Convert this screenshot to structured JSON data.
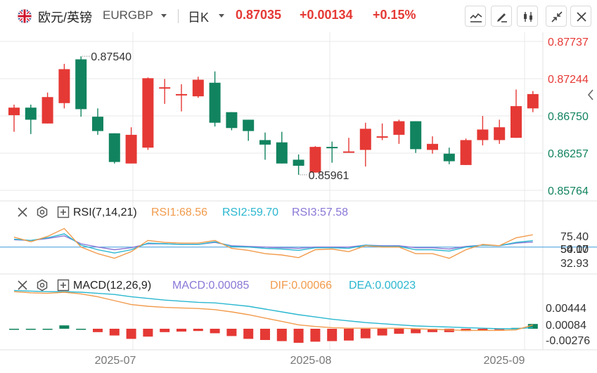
{
  "header": {
    "symbol_name": "欧元/英镑",
    "symbol_code": "EURGBP",
    "period": "日K",
    "price": "0.87035",
    "change": "+0.00134",
    "change_pct": "+0.15%"
  },
  "toolbar": {
    "icons": [
      "line-chart-icon",
      "draw-pencil-icon",
      "candle-type-icon",
      "collapse-icon",
      "close-icon"
    ]
  },
  "colors": {
    "up": "#e53935",
    "down": "#11835f",
    "rsi1": "#f29b4c",
    "rsi2": "#2ab7cf",
    "rsi3": "#8a77d6",
    "macd": "#8a77d6",
    "dif": "#f29b4c",
    "dea": "#2ab7cf",
    "grid": "#e8e8e8",
    "ref_line": "#3a9ad9"
  },
  "rsi": {
    "name": "RSI(7,14,21)",
    "rsi1_label": "RSI1:68.56",
    "rsi2_label": "RSI2:59.70",
    "rsi3_label": "RSI3:57.58"
  },
  "macd": {
    "name": "MACD(12,26,9)",
    "macd_label": "MACD:0.00085",
    "dif_label": "DIF:0.00066",
    "dea_label": "DEA:0.00023"
  },
  "chart_data": {
    "type": "candlestick",
    "price_axis": {
      "ticks": [
        0.87737,
        0.87244,
        0.8675,
        0.86257,
        0.85764
      ],
      "labels": [
        "0.87737",
        "0.87244",
        "0.86750",
        "0.86257",
        "0.85764"
      ]
    },
    "annotations": {
      "high_label": "0.87540",
      "low_label": "0.85961"
    },
    "x_labels": [
      "2025-07",
      "2025-08",
      "2025-09"
    ],
    "x_label_after_index": [
      7,
      18,
      29
    ],
    "candles": [
      {
        "o": 0.8676,
        "h": 0.869,
        "l": 0.8654,
        "c": 0.8686
      },
      {
        "o": 0.8686,
        "h": 0.869,
        "l": 0.8651,
        "c": 0.867
      },
      {
        "o": 0.8665,
        "h": 0.8706,
        "l": 0.8665,
        "c": 0.87
      },
      {
        "o": 0.8692,
        "h": 0.8744,
        "l": 0.8685,
        "c": 0.8737
      },
      {
        "o": 0.875,
        "h": 0.8754,
        "l": 0.8674,
        "c": 0.8684
      },
      {
        "o": 0.8674,
        "h": 0.8685,
        "l": 0.865,
        "c": 0.8655
      },
      {
        "o": 0.8652,
        "h": 0.8652,
        "l": 0.8612,
        "c": 0.8614
      },
      {
        "o": 0.8612,
        "h": 0.866,
        "l": 0.8612,
        "c": 0.865
      },
      {
        "o": 0.8633,
        "h": 0.8726,
        "l": 0.863,
        "c": 0.8725
      },
      {
        "o": 0.8713,
        "h": 0.8724,
        "l": 0.8691,
        "c": 0.8713
      },
      {
        "o": 0.8704,
        "h": 0.8717,
        "l": 0.8681,
        "c": 0.8704
      },
      {
        "o": 0.8701,
        "h": 0.8727,
        "l": 0.8699,
        "c": 0.8723
      },
      {
        "o": 0.8719,
        "h": 0.8734,
        "l": 0.8661,
        "c": 0.8666
      },
      {
        "o": 0.868,
        "h": 0.868,
        "l": 0.8656,
        "c": 0.8659
      },
      {
        "o": 0.867,
        "h": 0.867,
        "l": 0.8642,
        "c": 0.8655
      },
      {
        "o": 0.8643,
        "h": 0.8653,
        "l": 0.8617,
        "c": 0.8637
      },
      {
        "o": 0.864,
        "h": 0.8654,
        "l": 0.8612,
        "c": 0.8612
      },
      {
        "o": 0.8617,
        "h": 0.8624,
        "l": 0.8597,
        "c": 0.8609
      },
      {
        "o": 0.86,
        "h": 0.8635,
        "l": 0.86,
        "c": 0.8634
      },
      {
        "o": 0.8634,
        "h": 0.8641,
        "l": 0.8613,
        "c": 0.8633
      },
      {
        "o": 0.8628,
        "h": 0.8646,
        "l": 0.8628,
        "c": 0.8628
      },
      {
        "o": 0.863,
        "h": 0.8666,
        "l": 0.8608,
        "c": 0.8658
      },
      {
        "o": 0.8648,
        "h": 0.8665,
        "l": 0.8643,
        "c": 0.8648
      },
      {
        "o": 0.865,
        "h": 0.867,
        "l": 0.8638,
        "c": 0.8668
      },
      {
        "o": 0.8668,
        "h": 0.8668,
        "l": 0.8626,
        "c": 0.8631
      },
      {
        "o": 0.863,
        "h": 0.8648,
        "l": 0.8625,
        "c": 0.8638
      },
      {
        "o": 0.8625,
        "h": 0.8633,
        "l": 0.8611,
        "c": 0.8615
      },
      {
        "o": 0.861,
        "h": 0.8645,
        "l": 0.861,
        "c": 0.8643
      },
      {
        "o": 0.8643,
        "h": 0.8675,
        "l": 0.8636,
        "c": 0.8657
      },
      {
        "o": 0.8643,
        "h": 0.867,
        "l": 0.8638,
        "c": 0.866
      },
      {
        "o": 0.8646,
        "h": 0.871,
        "l": 0.8646,
        "c": 0.8688
      },
      {
        "o": 0.8685,
        "h": 0.8708,
        "l": 0.868,
        "c": 0.8704
      }
    ],
    "rsi_axis": {
      "labels": [
        "75.40",
        "54.17",
        "50.00",
        "32.93"
      ],
      "values": [
        75.4,
        54.17,
        50.0,
        32.93
      ]
    },
    "rsi1": [
      65,
      58,
      66,
      78,
      50,
      40,
      33,
      43,
      60,
      57,
      56,
      56,
      60,
      48,
      45,
      40,
      38,
      34,
      46,
      47,
      43,
      52,
      50,
      50,
      40,
      40,
      33,
      46,
      54,
      52,
      64,
      68.56
    ],
    "rsi2": [
      62,
      60,
      64,
      70,
      53,
      46,
      41,
      46,
      56,
      55,
      54,
      54,
      58,
      51,
      50,
      48,
      47,
      45,
      49,
      49,
      48,
      53,
      51,
      51,
      46,
      46,
      44,
      50,
      53,
      52,
      57,
      59.7
    ],
    "rsi3": [
      61,
      60,
      63,
      67,
      55,
      50,
      46,
      49,
      55,
      55,
      54,
      54,
      57,
      52,
      51,
      50,
      49,
      48,
      50,
      50,
      50,
      53,
      52,
      52,
      49,
      49,
      47,
      51,
      53,
      52,
      56,
      57.58
    ],
    "macd_axis": {
      "labels": [
        "0.00444",
        "0.00084",
        "-0.00276"
      ],
      "values": [
        0.00444,
        0.00084,
        -0.00276
      ]
    },
    "macd_hist": [
      0,
      0,
      0,
      0.0006,
      0,
      -0.0006,
      -0.0012,
      -0.0018,
      -0.0014,
      -0.0006,
      -0.0005,
      -0.0004,
      -0.0008,
      -0.0013,
      -0.0018,
      -0.002,
      -0.0022,
      -0.0025,
      -0.0023,
      -0.0022,
      -0.0021,
      -0.0017,
      -0.0012,
      -0.0009,
      -0.0008,
      -0.0006,
      -0.0006,
      -0.0004,
      -0.0003,
      -0.0002,
      0.00015,
      0.00085
    ],
    "dif": [
      0.0066,
      0.0064,
      0.0063,
      0.0065,
      0.0062,
      0.0057,
      0.005,
      0.0043,
      0.004,
      0.0038,
      0.0037,
      0.0036,
      0.0034,
      0.003,
      0.0025,
      0.0019,
      0.0013,
      0.0007,
      0.0004,
      0.0002,
      0.0001,
      0.0001,
      0.0001,
      0.0001,
      0.0,
      -0.0001,
      -0.0002,
      -0.0003,
      -0.0003,
      -0.0003,
      -0.0002,
      0.00066
    ],
    "dea": [
      0.0068,
      0.0067,
      0.0066,
      0.0066,
      0.0065,
      0.0063,
      0.0061,
      0.0057,
      0.0054,
      0.0051,
      0.0049,
      0.0047,
      0.0046,
      0.0043,
      0.004,
      0.0035,
      0.003,
      0.0025,
      0.0021,
      0.0017,
      0.0014,
      0.0011,
      0.0009,
      0.0007,
      0.0005,
      0.0004,
      0.0003,
      0.0002,
      0.0001,
      0.0,
      0.0,
      0.00023
    ]
  }
}
